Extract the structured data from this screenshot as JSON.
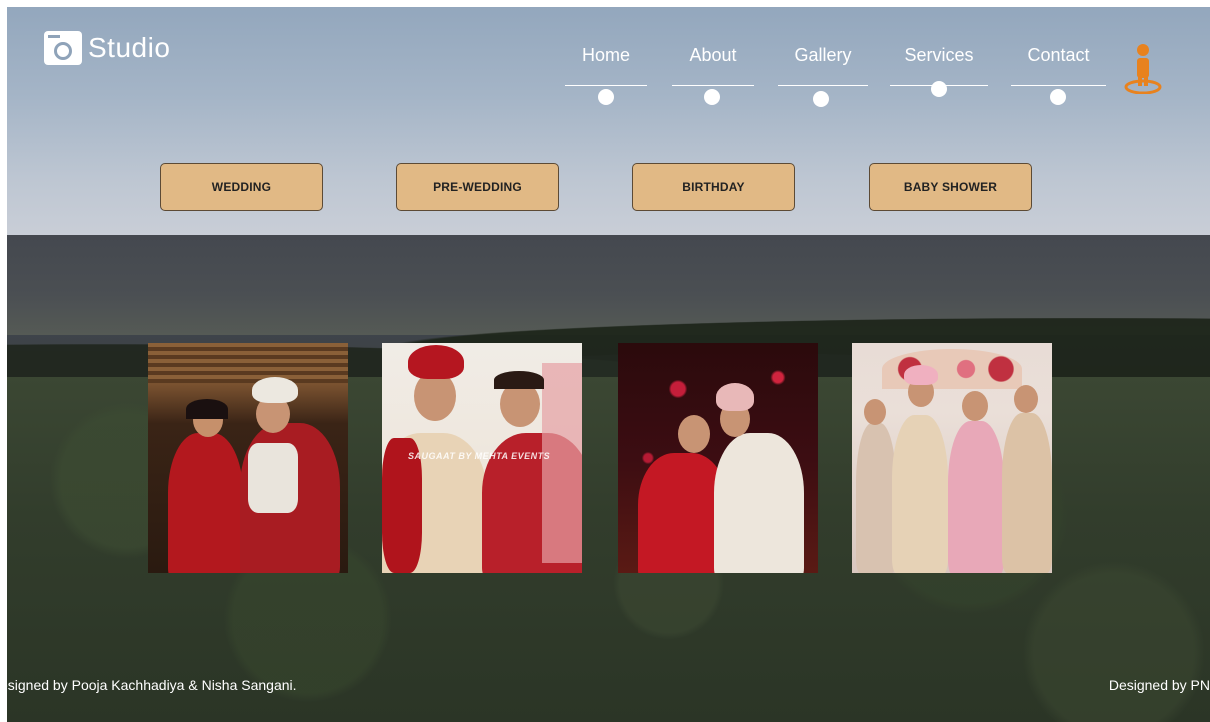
{
  "brand": {
    "name": "Studio",
    "icon": "camera-icon"
  },
  "nav": {
    "items": [
      {
        "label": "Home"
      },
      {
        "label": "About"
      },
      {
        "label": "Gallery"
      },
      {
        "label": "Services"
      },
      {
        "label": "Contact"
      }
    ],
    "user_icon": "person-location-icon",
    "accent": "#e8821e"
  },
  "categories": [
    {
      "label": "WEDDING"
    },
    {
      "label": "PRE-WEDDING"
    },
    {
      "label": "BIRTHDAY"
    },
    {
      "label": "BABY SHOWER"
    }
  ],
  "colors": {
    "button_bg": "#e1b985",
    "button_border": "#5c4a35",
    "text": "#ffffff"
  },
  "gallery": {
    "photos": [
      {
        "watermark": ""
      },
      {
        "watermark": "SAUGAAT BY MEHTA EVENTS"
      },
      {
        "watermark": ""
      },
      {
        "watermark": ""
      }
    ]
  },
  "footer": {
    "left": "esigned by Pooja Kachhadiya & Nisha Sangani.",
    "right": "Designed by PN"
  }
}
